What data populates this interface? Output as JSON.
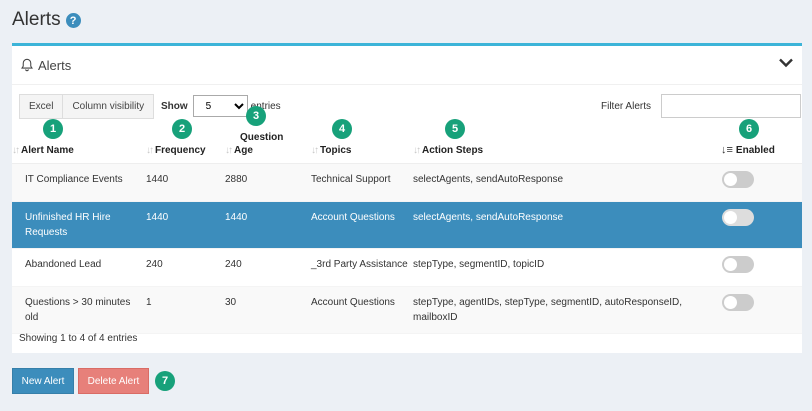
{
  "page": {
    "title": "Alerts",
    "help_icon": "?"
  },
  "box": {
    "title": "Alerts",
    "icons": {
      "bell": "bell-icon",
      "collapse": "chevron-down-icon"
    }
  },
  "toolbar": {
    "excel_label": "Excel",
    "column_visibility_label": "Column visibility",
    "show_label": "Show",
    "entries_value": "5",
    "entries_suffix": "entries",
    "filter_label": "Filter Alerts",
    "filter_value": ""
  },
  "table": {
    "columns": [
      {
        "label": "Alert Name",
        "badge": "1"
      },
      {
        "label": "Frequency",
        "badge": "2"
      },
      {
        "label_line1": "Question",
        "label_line2": "Age",
        "badge": "3"
      },
      {
        "label": "Topics",
        "badge": "4"
      },
      {
        "label": "Action Steps",
        "badge": "5"
      },
      {
        "label": "Enabled",
        "badge": "6"
      }
    ],
    "rows": [
      {
        "name": "IT Compliance Events",
        "frequency": "1440",
        "age": "2880",
        "topics": "Technical Support",
        "actions": "selectAgents, sendAutoResponse",
        "enabled": false,
        "selected": false
      },
      {
        "name": "Unfinished HR Hire Requests",
        "frequency": "1440",
        "age": "1440",
        "topics": "Account Questions",
        "actions": "selectAgents, sendAutoResponse",
        "enabled": false,
        "selected": true
      },
      {
        "name": "Abandoned Lead",
        "frequency": "240",
        "age": "240",
        "topics": "_3rd Party Assistance",
        "actions": "stepType, segmentID, topicID",
        "enabled": false,
        "selected": false
      },
      {
        "name": "Questions > 30 minutes old",
        "frequency": "1",
        "age": "30",
        "topics": "Account Questions",
        "actions": "stepType, agentIDs, stepType, segmentID, autoResponseID, mailboxID",
        "enabled": false,
        "selected": false
      }
    ],
    "info": "Showing 1 to 4 of 4 entries"
  },
  "footer": {
    "new_alert_label": "New Alert",
    "delete_alert_label": "Delete Alert",
    "badge": "7"
  },
  "colors": {
    "accent": "#3c8dbc",
    "badge": "#17a17a",
    "danger": "#e7807a",
    "box_border": "#3cb4d8"
  }
}
